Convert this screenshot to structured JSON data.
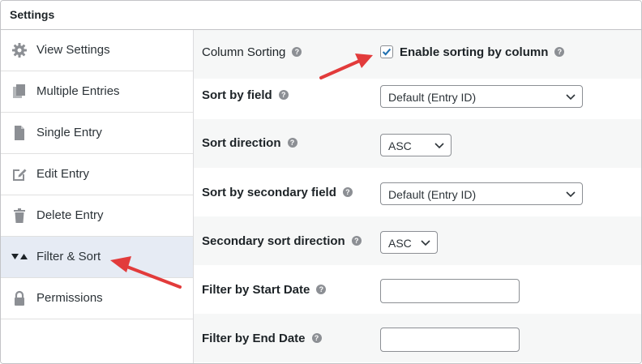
{
  "panel": {
    "title": "Settings"
  },
  "sidebar": {
    "items": [
      {
        "label": "View Settings",
        "icon": "gear-icon"
      },
      {
        "label": "Multiple Entries",
        "icon": "multiple-documents-icon"
      },
      {
        "label": "Single Entry",
        "icon": "document-icon"
      },
      {
        "label": "Edit Entry",
        "icon": "edit-icon"
      },
      {
        "label": "Delete Entry",
        "icon": "trash-icon"
      },
      {
        "label": "Filter & Sort",
        "icon": "filter-sort-icon",
        "active": true
      },
      {
        "label": "Permissions",
        "icon": "lock-icon"
      }
    ]
  },
  "settings": {
    "column_sorting": {
      "label": "Column Sorting",
      "checkbox_label": "Enable sorting by column",
      "checked": true
    },
    "sort_by_field": {
      "label": "Sort by field",
      "value": "Default (Entry ID)"
    },
    "sort_direction": {
      "label": "Sort direction",
      "value": "ASC"
    },
    "sort_by_secondary_field": {
      "label": "Sort by secondary field",
      "value": "Default (Entry ID)"
    },
    "secondary_sort_direction": {
      "label": "Secondary sort direction",
      "value": "ASC"
    },
    "filter_start_date": {
      "label": "Filter by Start Date",
      "value": ""
    },
    "filter_end_date": {
      "label": "Filter by End Date",
      "value": ""
    }
  },
  "colors": {
    "accent": "#2271b1",
    "annotation_arrow": "#e23b3b",
    "active_sidebar_bg": "#e6ebf4",
    "shaded_row_bg": "#f6f7f7"
  },
  "help_glyph": "?"
}
